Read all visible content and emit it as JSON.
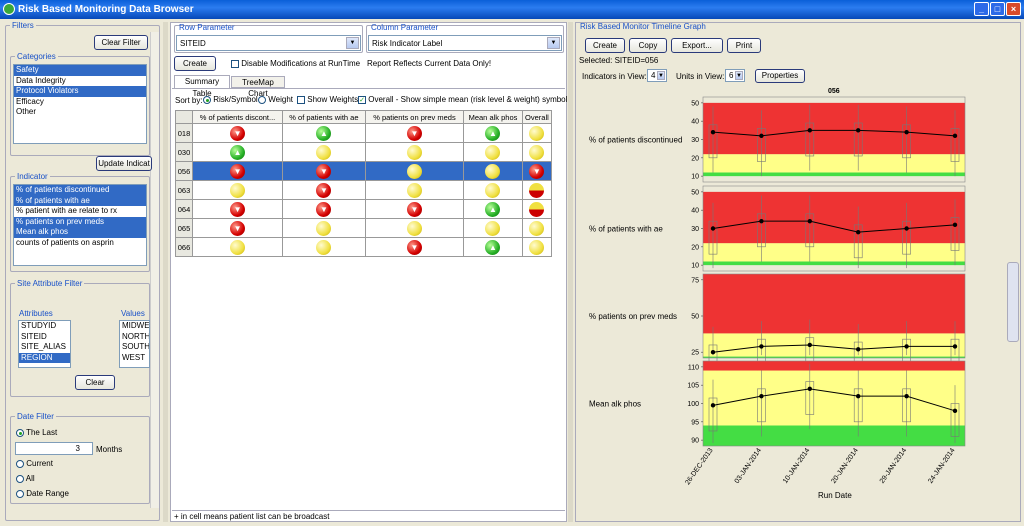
{
  "window": {
    "title": "Risk Based Monitoring Data Browser",
    "min": "_",
    "max": "□",
    "close": "×"
  },
  "filters": {
    "title": "Filters",
    "clear_filter": "Clear Filter",
    "categories": {
      "title": "Categories",
      "items": [
        {
          "label": "Safety",
          "sel": true
        },
        {
          "label": "Data Indegrity",
          "sel": false
        },
        {
          "label": "Protocol Violators",
          "sel": true
        },
        {
          "label": "Efficacy",
          "sel": false
        },
        {
          "label": "Other",
          "sel": false
        }
      ]
    },
    "update_label": "Update Indicat",
    "indicator": {
      "title": "Indicator",
      "items": [
        {
          "label": "% of patients discontinued",
          "sel": true
        },
        {
          "label": "% of patients with ae",
          "sel": true
        },
        {
          "label": "% patient with ae relate to rx",
          "sel": false
        },
        {
          "label": "% patients on prev meds",
          "sel": true
        },
        {
          "label": "Mean alk phos",
          "sel": true
        },
        {
          "label": "counts of patients on asprin",
          "sel": false
        }
      ]
    },
    "site_attr": {
      "title": "Site Attribute Filter",
      "attributes_label": "Attributes",
      "values_label": "Values",
      "attributes": [
        "STUDYID",
        "SITEID",
        "SITE_ALIAS",
        "REGION"
      ],
      "values": [
        "MIDWEST",
        "NORTHEA",
        "SOUTHW",
        "WEST"
      ],
      "clear": "Clear"
    },
    "date": {
      "title": "Date Filter",
      "the_last": "The Last",
      "months_value": "3",
      "months": "Months",
      "current": "Current",
      "all": "All",
      "range": "Date Range"
    }
  },
  "center": {
    "row_param": {
      "title": "Row Parameter",
      "value": "SITEID"
    },
    "col_param": {
      "title": "Column Parameter",
      "value": "Risk Indicator Label"
    },
    "create": "Create",
    "disable": "Disable Modifications at RunTime",
    "reflects": "Report Reflects Current Data Only!",
    "tabs": [
      "Summary Table",
      "TreeMap Chart"
    ],
    "sortby": "Sort by:",
    "risk_symbol": "Risk/Symbol",
    "weight": "Weight",
    "show_weights": "Show Weights",
    "overall_desc": "Overall - Show simple mean (risk level & weight) symbol",
    "columns": [
      "% of patients discont...",
      "% of patients with ae",
      "% patients on prev meds",
      "Mean alk phos",
      "Overall"
    ],
    "rows": [
      {
        "id": "018",
        "cells": [
          "red",
          "green",
          "red",
          "green",
          "yellow"
        ]
      },
      {
        "id": "030",
        "cells": [
          "green",
          "yellow",
          "yellow",
          "yellow",
          "yellow"
        ]
      },
      {
        "id": "056",
        "cells": [
          "red",
          "red",
          "yellow",
          "yellow",
          "red"
        ],
        "sel": true
      },
      {
        "id": "063",
        "cells": [
          "yellow",
          "red",
          "yellow",
          "yellow",
          "half"
        ]
      },
      {
        "id": "064",
        "cells": [
          "red",
          "red",
          "red",
          "green",
          "half"
        ]
      },
      {
        "id": "065",
        "cells": [
          "red",
          "yellow",
          "yellow",
          "yellow",
          "yellow"
        ]
      },
      {
        "id": "066",
        "cells": [
          "yellow",
          "yellow",
          "red",
          "green",
          "yellow"
        ]
      }
    ],
    "footer": "+ in cell means patient list can be broadcast"
  },
  "graph": {
    "title": "Risk Based Monitor Timeline Graph",
    "buttons": [
      "Create",
      "Copy",
      "Export...",
      "Print"
    ],
    "selected": "Selected: SITEID=056",
    "ind_label": "Indicators in View:",
    "ind_val": "4",
    "units_label": "Units in View:",
    "units_val": "6",
    "properties": "Properties",
    "site": "056",
    "xlabel": "Run Date",
    "dates": [
      "26-DEC-2013",
      "03-JAN-2014",
      "10-JAN-2014",
      "20-JAN-2014",
      "29-JAN-2014",
      "24-JAN-2014"
    ]
  },
  "chart_data": {
    "type": "line",
    "x": [
      "26-DEC-2013",
      "03-JAN-2014",
      "10-JAN-2014",
      "20-JAN-2014",
      "29-JAN-2014",
      "24-JAN-2014"
    ],
    "xlabel": "Run Date",
    "title": "056",
    "panels": [
      {
        "name": "% of patients discontinued",
        "ylim": [
          10,
          50
        ],
        "ticks": [
          10,
          20,
          30,
          40,
          50
        ],
        "values": [
          34,
          32,
          35,
          35,
          34,
          32
        ],
        "bands": [
          {
            "from": 10,
            "to": 12,
            "color": "#44dd44"
          },
          {
            "from": 12,
            "to": 22,
            "color": "#ffff88"
          },
          {
            "from": 22,
            "to": 50,
            "color": "#ee3333"
          }
        ]
      },
      {
        "name": "% of patients with ae",
        "ylim": [
          10,
          50
        ],
        "ticks": [
          10,
          20,
          30,
          40,
          50
        ],
        "values": [
          30,
          34,
          34,
          28,
          30,
          32
        ],
        "bands": [
          {
            "from": 10,
            "to": 12,
            "color": "#44dd44"
          },
          {
            "from": 12,
            "to": 22,
            "color": "#ffff88"
          },
          {
            "from": 22,
            "to": 50,
            "color": "#ee3333"
          }
        ]
      },
      {
        "name": "% patients on prev meds",
        "ylim": [
          25,
          75
        ],
        "ticks": [
          25,
          50,
          75
        ],
        "values": [
          25,
          29,
          30,
          27,
          29,
          29
        ],
        "bands": [
          {
            "from": 20,
            "to": 22,
            "color": "#44dd44"
          },
          {
            "from": 22,
            "to": 38,
            "color": "#ffff88"
          },
          {
            "from": 38,
            "to": 80,
            "color": "#ee3333"
          }
        ]
      },
      {
        "name": "Mean alk phos",
        "ylim": [
          90,
          110
        ],
        "ticks": [
          90,
          95,
          100,
          105,
          110
        ],
        "values": [
          99.5,
          102,
          104,
          102,
          102,
          98
        ],
        "bands": [
          {
            "from": 88,
            "to": 94,
            "color": "#44dd44"
          },
          {
            "from": 94,
            "to": 109,
            "color": "#ffff88"
          },
          {
            "from": 109,
            "to": 112,
            "color": "#ee3333"
          }
        ]
      }
    ]
  },
  "colors": {
    "accent": "#316ac5",
    "title_bar": "#0a5fd8"
  }
}
